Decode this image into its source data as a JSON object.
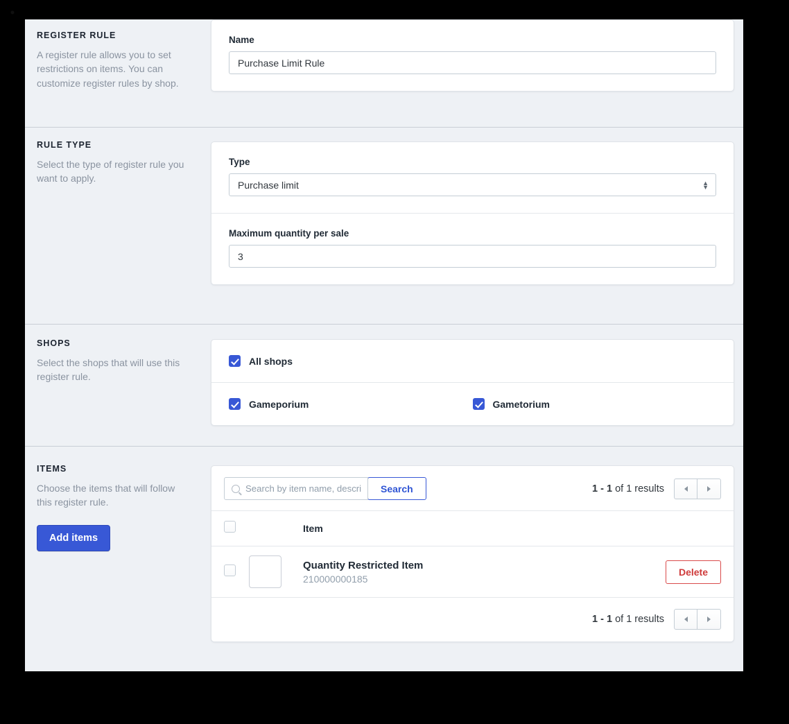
{
  "sections": {
    "register_rule": {
      "title": "REGISTER RULE",
      "description": "A register rule allows you to set restrictions on items. You can customize register rules by shop.",
      "name_label": "Name",
      "name_value": "Purchase Limit Rule"
    },
    "rule_type": {
      "title": "RULE TYPE",
      "description": "Select the type of register rule you want to apply.",
      "type_label": "Type",
      "type_value": "Purchase limit",
      "max_qty_label": "Maximum quantity per sale",
      "max_qty_value": "3"
    },
    "shops": {
      "title": "SHOPS",
      "description": "Select the shops that will use this register rule.",
      "all_shops_label": "All shops",
      "all_shops_checked": true,
      "list": [
        {
          "label": "Gameporium",
          "checked": true
        },
        {
          "label": "Gametorium",
          "checked": true
        }
      ]
    },
    "items": {
      "title": "ITEMS",
      "description": "Choose the items that will follow this register rule.",
      "add_items_label": "Add items",
      "search_placeholder": "Search by item name, description, SKU, U",
      "search_value": "",
      "search_button_label": "Search",
      "pagination_range": "1 - 1",
      "pagination_suffix": " of 1 results",
      "column_header_item": "Item",
      "rows": [
        {
          "name": "Quantity Restricted Item",
          "sku": "210000000185",
          "selected": false,
          "delete_label": "Delete"
        }
      ]
    }
  },
  "colors": {
    "accent_blue": "#3858d6",
    "danger_red": "#cf3b3b",
    "page_bg": "#eef1f5",
    "card_bg": "#ffffff",
    "muted_text": "#8a93a0"
  },
  "icons": {
    "search": "search-icon",
    "prev": "chevron-left-icon",
    "next": "chevron-right-icon",
    "stepper": "select-stepper-icon"
  }
}
